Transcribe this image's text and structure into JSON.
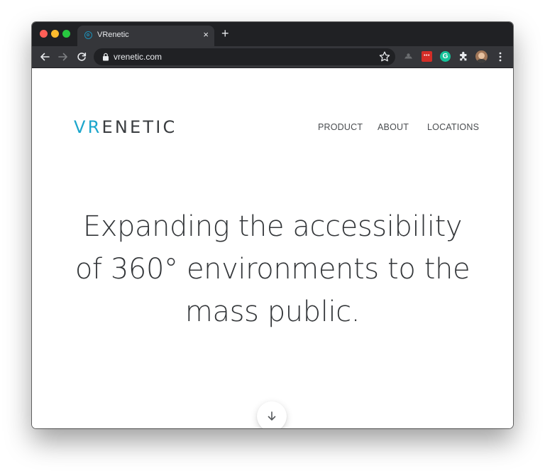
{
  "browser": {
    "tab_title": "VRenetic",
    "tab_close": "×",
    "new_tab": "+",
    "url": "vrenetic.com",
    "extension_lastpass_text": "•••",
    "extension_grammarly_text": "G"
  },
  "site": {
    "logo_vr": "VR",
    "logo_rest": "ENETIC",
    "nav": [
      "PRODUCT",
      "ABOUT",
      "LOCATIONS"
    ],
    "hero_lines": [
      "Expanding the accessibility",
      "of 360° environments to the",
      "mass public."
    ]
  },
  "colors": {
    "brand_accent": "#1ca6cc",
    "logo_dark": "#3a3d40",
    "browser_frame": "#202124",
    "browser_toolbar": "#35363a"
  },
  "icons": {
    "back": "arrow-left-icon",
    "forward": "arrow-right-icon",
    "reload": "reload-icon",
    "lock": "lock-icon",
    "bookmark": "star-icon",
    "scroll": "arrow-down-icon"
  }
}
